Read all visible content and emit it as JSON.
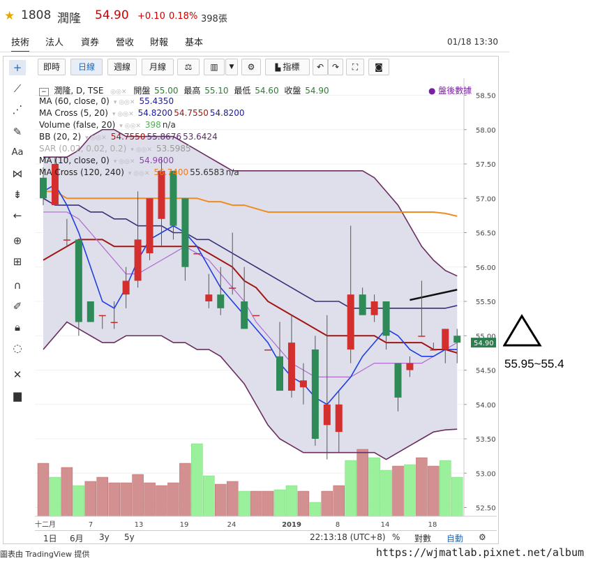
{
  "header": {
    "code": "1808",
    "name": "潤隆",
    "price": "54.90",
    "change": "+0.10",
    "pct": "0.18%",
    "volume": "398張"
  },
  "tabs": [
    "技術",
    "法人",
    "資券",
    "營收",
    "財報",
    "基本"
  ],
  "datetime": "01/18 13:30",
  "toolbar": {
    "intraday": "即時",
    "daily": "日線",
    "weekly": "週線",
    "monthly": "月線",
    "indicators": "指標"
  },
  "legend": {
    "main": {
      "title": "潤隆, D, TSE",
      "open_label": "開盤",
      "open": "55.00",
      "high_label": "最高",
      "high": "55.10",
      "low_label": "最低",
      "low": "54.60",
      "close_label": "收盤",
      "close": "54.90"
    },
    "after_hours": "盤後數據",
    "rows": [
      {
        "name": "MA (60, close, 0)",
        "values": [
          "55.4350"
        ],
        "colors": [
          "#1a1aa6"
        ]
      },
      {
        "name": "MA Cross (5, 20)",
        "values": [
          "54.8200",
          "54.7550",
          "54.8200"
        ],
        "colors": [
          "#1a1aa6",
          "#a31515",
          "#1a1aa6"
        ]
      },
      {
        "name": "Volume (false, 20)",
        "values": [
          "398",
          "n/a"
        ],
        "colors": [
          "#4caf50",
          "#333333"
        ]
      },
      {
        "name": "BB (20, 2)",
        "values": [
          "54.7550",
          "55.8676",
          "53.6424"
        ],
        "colors": [
          "#a31515",
          "#5b2c6f",
          "#5b2c6f"
        ]
      },
      {
        "name": "SAR (0.02, 0.02, 0.2)",
        "values": [
          "53.5985"
        ],
        "colors": [
          "#999999"
        ]
      },
      {
        "name": "MA (10, close, 0)",
        "values": [
          "54.9600"
        ],
        "colors": [
          "#8e44ad"
        ]
      },
      {
        "name": "MA Cross (120, 240)",
        "values": [
          "56.7400",
          "55.6583",
          "n/a"
        ],
        "colors": [
          "#e67e22",
          "#333333",
          "#333333"
        ]
      }
    ]
  },
  "chart_data": {
    "type": "candlestick",
    "y_ticks": [
      "58.50",
      "58.00",
      "57.50",
      "57.00",
      "56.50",
      "56.00",
      "55.50",
      "55.00",
      "54.50",
      "54.00",
      "53.50",
      "53.00",
      "52.50"
    ],
    "last_price_label": "54.90",
    "x_ticks": [
      "十二月",
      "7",
      "13",
      "19",
      "24",
      "2019",
      "8",
      "14",
      "18"
    ],
    "candles": [
      {
        "o": 57.3,
        "h": 57.45,
        "l": 56.9,
        "c": 57.0
      },
      {
        "o": 56.9,
        "h": 57.6,
        "l": 56.9,
        "c": 57.5
      },
      {
        "o": 56.4,
        "h": 56.7,
        "l": 56.3,
        "c": 56.4
      },
      {
        "o": 56.4,
        "h": 56.4,
        "l": 55.0,
        "c": 55.2
      },
      {
        "o": 55.5,
        "h": 55.5,
        "l": 55.2,
        "c": 55.2
      },
      {
        "o": 55.3,
        "h": 55.3,
        "l": 55.1,
        "c": 55.3
      },
      {
        "o": 55.2,
        "h": 55.5,
        "l": 55.1,
        "c": 55.2
      },
      {
        "o": 55.6,
        "h": 56.0,
        "l": 55.4,
        "c": 55.8
      },
      {
        "o": 55.8,
        "h": 57.1,
        "l": 55.7,
        "c": 56.4
      },
      {
        "o": 56.2,
        "h": 57.0,
        "l": 56.1,
        "c": 57.0
      },
      {
        "o": 56.7,
        "h": 57.6,
        "l": 56.3,
        "c": 57.4
      },
      {
        "o": 57.4,
        "h": 57.4,
        "l": 56.4,
        "c": 56.6
      },
      {
        "o": 57.0,
        "h": 57.0,
        "l": 55.8,
        "c": 56.0
      },
      {
        "o": 56.2,
        "h": 56.2,
        "l": 56.2,
        "c": 56.2
      },
      {
        "o": 55.5,
        "h": 55.9,
        "l": 55.4,
        "c": 55.6
      },
      {
        "o": 55.6,
        "h": 56.0,
        "l": 55.3,
        "c": 55.4
      },
      {
        "o": 55.7,
        "h": 56.5,
        "l": 55.6,
        "c": 55.7
      },
      {
        "o": 55.5,
        "h": 56.0,
        "l": 55.1,
        "c": 55.1
      },
      {
        "o": 55.3,
        "h": 55.3,
        "l": 55.3,
        "c": 55.3
      },
      {
        "o": 54.8,
        "h": 54.8,
        "l": 54.8,
        "c": 54.8
      },
      {
        "o": 54.7,
        "h": 55.2,
        "l": 54.6,
        "c": 54.2
      },
      {
        "o": 54.2,
        "h": 55.3,
        "l": 54.1,
        "c": 54.9
      },
      {
        "o": 54.25,
        "h": 54.6,
        "l": 54.0,
        "c": 54.35
      },
      {
        "o": 54.8,
        "h": 55.0,
        "l": 53.4,
        "c": 53.5
      },
      {
        "o": 53.7,
        "h": 55.3,
        "l": 53.2,
        "c": 54.0
      },
      {
        "o": 53.6,
        "h": 54.2,
        "l": 53.3,
        "c": 54.0
      },
      {
        "o": 54.8,
        "h": 56.6,
        "l": 54.6,
        "c": 55.6
      },
      {
        "o": 55.6,
        "h": 55.7,
        "l": 55.3,
        "c": 55.3
      },
      {
        "o": 55.3,
        "h": 55.6,
        "l": 55.2,
        "c": 55.5
      },
      {
        "o": 55.5,
        "h": 55.5,
        "l": 54.8,
        "c": 55.0
      },
      {
        "o": 54.6,
        "h": 54.6,
        "l": 53.9,
        "c": 54.1
      },
      {
        "o": 54.5,
        "h": 54.7,
        "l": 54.4,
        "c": 54.6
      },
      {
        "o": 55.0,
        "h": 55.8,
        "l": 55.0,
        "c": 55.0
      },
      {
        "o": 54.8,
        "h": 54.9,
        "l": 54.8,
        "c": 54.8
      },
      {
        "o": 54.8,
        "h": 55.1,
        "l": 54.6,
        "c": 55.1
      },
      {
        "o": 55.0,
        "h": 55.1,
        "l": 54.6,
        "c": 54.9
      }
    ],
    "ma5": [
      57.1,
      57.2,
      56.9,
      56.5,
      56.0,
      55.5,
      55.4,
      55.7,
      56.1,
      56.4,
      56.5,
      56.6,
      56.5,
      56.3,
      56.0,
      55.7,
      55.5,
      55.3,
      55.1,
      54.9,
      54.6,
      54.4,
      54.3,
      54.1,
      54.0,
      54.2,
      54.4,
      54.7,
      54.9,
      55.1,
      55.0,
      54.8,
      54.7,
      54.7,
      54.8,
      54.8
    ],
    "ma10": [
      56.8,
      56.8,
      56.8,
      56.7,
      56.5,
      56.3,
      56.1,
      55.9,
      55.9,
      56.0,
      56.1,
      56.2,
      56.3,
      56.2,
      56.1,
      55.9,
      55.7,
      55.5,
      55.2,
      55.0,
      54.8,
      54.6,
      54.5,
      54.4,
      54.4,
      54.4,
      54.4,
      54.5,
      54.6,
      54.6,
      54.6,
      54.6,
      54.6,
      54.7,
      54.8,
      54.9
    ],
    "ma20": [
      56.1,
      56.2,
      56.3,
      56.4,
      56.4,
      56.4,
      56.3,
      56.3,
      56.3,
      56.3,
      56.3,
      56.3,
      56.3,
      56.3,
      56.2,
      56.1,
      56.0,
      55.8,
      55.7,
      55.5,
      55.4,
      55.3,
      55.2,
      55.1,
      55.0,
      55.0,
      55.0,
      55.0,
      55.0,
      54.9,
      54.9,
      54.9,
      54.9,
      54.8,
      54.8,
      54.75
    ],
    "ma60": [
      57.0,
      56.9,
      56.9,
      56.9,
      56.8,
      56.8,
      56.7,
      56.7,
      56.6,
      56.6,
      56.6,
      56.5,
      56.5,
      56.4,
      56.4,
      56.3,
      56.2,
      56.1,
      56.0,
      55.9,
      55.8,
      55.7,
      55.6,
      55.5,
      55.5,
      55.5,
      55.4,
      55.4,
      55.4,
      55.4,
      55.4,
      55.4,
      55.4,
      55.4,
      55.4,
      55.44
    ],
    "ma120": [
      57.1,
      57.1,
      57.0,
      57.0,
      57.0,
      57.0,
      57.0,
      57.0,
      57.0,
      57.0,
      57.0,
      57.0,
      57.0,
      57.0,
      56.95,
      56.95,
      56.9,
      56.9,
      56.85,
      56.8,
      56.8,
      56.8,
      56.8,
      56.8,
      56.8,
      56.8,
      56.8,
      56.8,
      56.8,
      56.8,
      56.8,
      56.8,
      56.8,
      56.8,
      56.78,
      56.74
    ],
    "bb_upper": [
      57.6,
      57.6,
      57.6,
      57.7,
      57.9,
      58.0,
      58.0,
      57.9,
      57.9,
      57.9,
      57.9,
      57.9,
      57.8,
      57.7,
      57.6,
      57.5,
      57.4,
      57.4,
      57.4,
      57.4,
      57.4,
      57.4,
      57.4,
      57.4,
      57.4,
      57.4,
      57.4,
      57.4,
      57.3,
      57.1,
      56.9,
      56.6,
      56.3,
      56.1,
      55.95,
      55.87
    ],
    "bb_lower": [
      54.8,
      55.0,
      55.2,
      55.1,
      55.0,
      54.9,
      54.9,
      55.0,
      55.0,
      55.0,
      55.0,
      54.9,
      54.9,
      54.8,
      54.8,
      54.7,
      54.5,
      54.3,
      54.0,
      53.7,
      53.5,
      53.4,
      53.3,
      53.3,
      53.3,
      53.3,
      53.3,
      53.3,
      53.3,
      53.2,
      53.3,
      53.4,
      53.5,
      53.6,
      53.63,
      53.64
    ],
    "trend_segment": [
      [
        31,
        55.52
      ],
      [
        35,
        55.67
      ]
    ],
    "volumes": [
      380,
      280,
      350,
      220,
      250,
      280,
      240,
      240,
      300,
      240,
      220,
      240,
      380,
      520,
      290,
      230,
      250,
      180,
      180,
      180,
      190,
      220,
      180,
      100,
      180,
      220,
      400,
      480,
      420,
      330,
      360,
      370,
      420,
      360,
      400,
      280
    ],
    "vol_up": [
      false,
      true,
      false,
      true,
      false,
      false,
      false,
      false,
      false,
      false,
      false,
      false,
      false,
      true,
      true,
      false,
      false,
      true,
      false,
      false,
      true,
      true,
      false,
      true,
      false,
      false,
      true,
      false,
      true,
      true,
      false,
      true,
      false,
      false,
      true,
      true
    ],
    "vol_max": 900
  },
  "bottom": {
    "ranges": [
      "1日",
      "6月",
      "3y",
      "5y"
    ],
    "time": "22:13:18 (UTC+8)",
    "percent": "%",
    "log": "對數",
    "auto": "自動"
  },
  "credit": "圖表由 TradingView 提供",
  "watermark": "https://wjmatlab.pixnet.net/album",
  "annotation": "55.95~55.4"
}
